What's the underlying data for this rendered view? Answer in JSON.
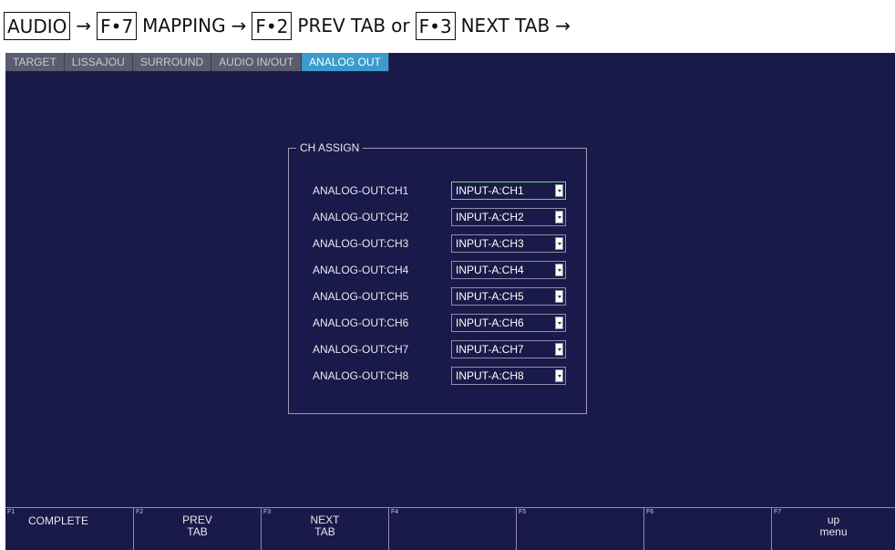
{
  "breadcrumb": {
    "audio": "AUDIO",
    "arrow": "→",
    "f7": "F•7",
    "mapping": "MAPPING",
    "f2": "F•2",
    "prev_tab": "PREV TAB",
    "or": "or",
    "f3": "F•3",
    "next_tab": "NEXT TAB"
  },
  "tabs": [
    {
      "label": "TARGET",
      "active": false
    },
    {
      "label": "LISSAJOU",
      "active": false
    },
    {
      "label": "SURROUND",
      "active": false
    },
    {
      "label": "AUDIO IN/OUT",
      "active": false
    },
    {
      "label": "ANALOG OUT",
      "active": true
    }
  ],
  "ch_assign": {
    "title": "CH ASSIGN",
    "rows": [
      {
        "label": "ANALOG-OUT:CH1",
        "value": "INPUT-A:CH1"
      },
      {
        "label": "ANALOG-OUT:CH2",
        "value": "INPUT-A:CH2"
      },
      {
        "label": "ANALOG-OUT:CH3",
        "value": "INPUT-A:CH3"
      },
      {
        "label": "ANALOG-OUT:CH4",
        "value": "INPUT-A:CH4"
      },
      {
        "label": "ANALOG-OUT:CH5",
        "value": "INPUT-A:CH5"
      },
      {
        "label": "ANALOG-OUT:CH6",
        "value": "INPUT-A:CH6"
      },
      {
        "label": "ANALOG-OUT:CH7",
        "value": "INPUT-A:CH7"
      },
      {
        "label": "ANALOG-OUT:CH8",
        "value": "INPUT-A:CH8"
      }
    ]
  },
  "fkeys": [
    {
      "num": "F1",
      "label": "COMPLETE"
    },
    {
      "num": "F2",
      "label": "PREV\nTAB"
    },
    {
      "num": "F3",
      "label": "NEXT\nTAB"
    },
    {
      "num": "F4",
      "label": ""
    },
    {
      "num": "F5",
      "label": ""
    },
    {
      "num": "F6",
      "label": ""
    },
    {
      "num": "F7",
      "label": "up\nmenu"
    }
  ],
  "colors": {
    "screen_bg": "#191a49",
    "active_tab": "#3a9ccc",
    "focus_border": "#7fd16b"
  }
}
